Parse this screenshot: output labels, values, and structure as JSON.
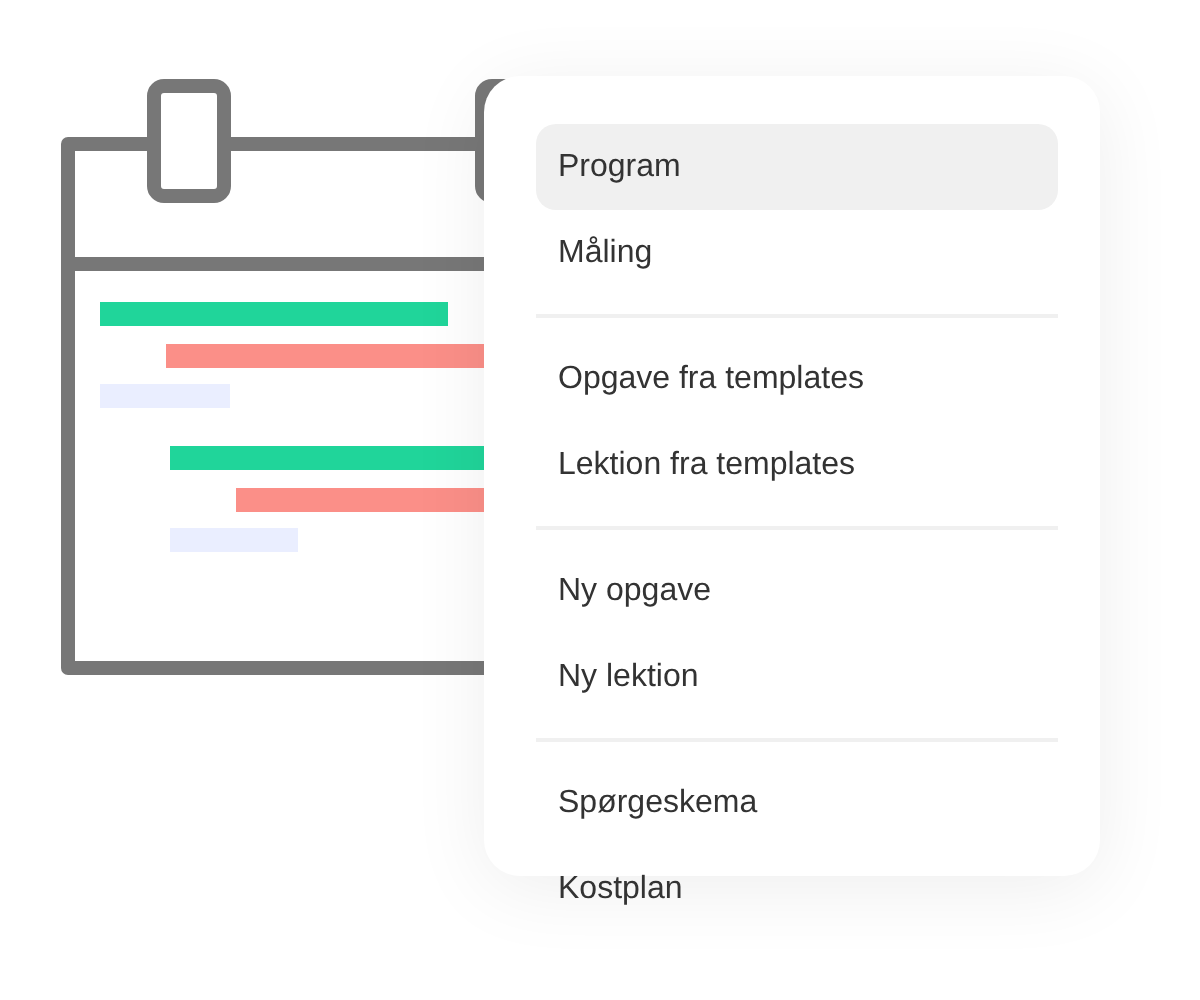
{
  "menu": {
    "groups": [
      {
        "items": [
          {
            "label": "Program",
            "selected": true
          },
          {
            "label": "Måling",
            "selected": false
          }
        ]
      },
      {
        "items": [
          {
            "label": "Opgave fra templates",
            "selected": false
          },
          {
            "label": "Lektion fra templates",
            "selected": false
          }
        ]
      },
      {
        "items": [
          {
            "label": "Ny opgave",
            "selected": false
          },
          {
            "label": "Ny lektion",
            "selected": false
          }
        ]
      },
      {
        "items": [
          {
            "label": "Spørgeskema",
            "selected": false
          },
          {
            "label": "Kostplan",
            "selected": false
          }
        ]
      }
    ]
  }
}
